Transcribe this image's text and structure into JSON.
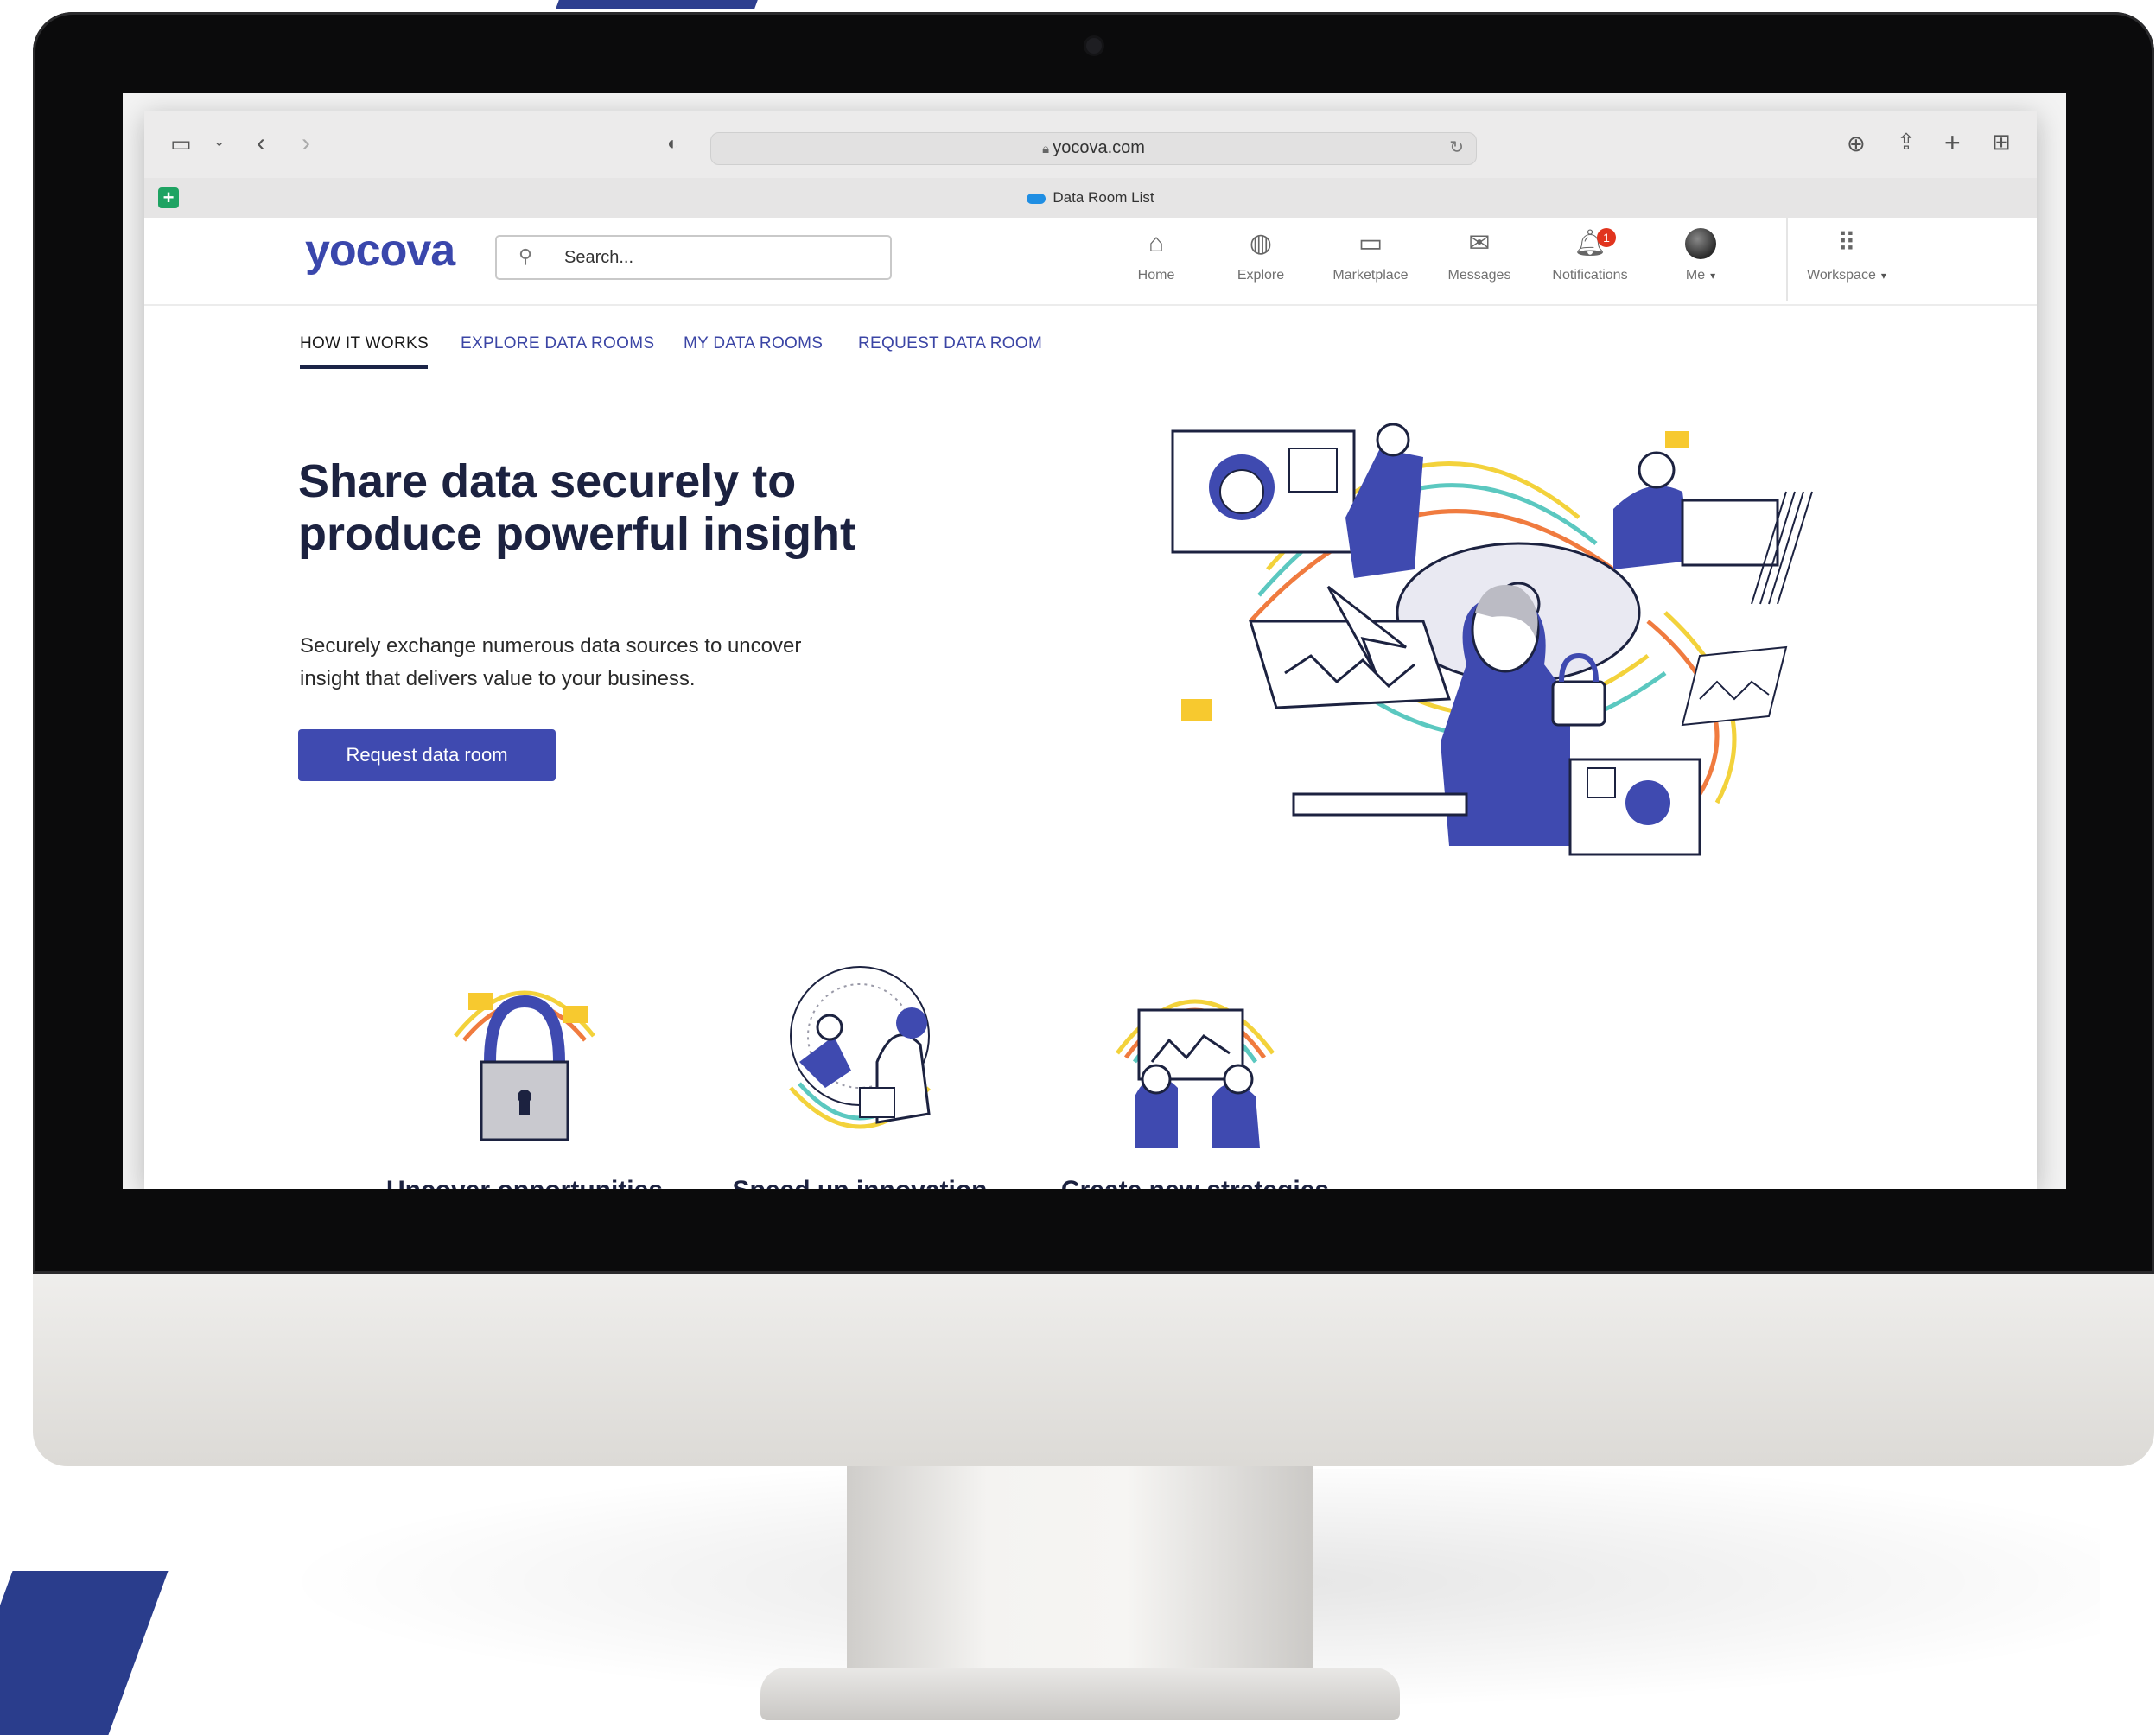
{
  "browser": {
    "url": "yocova.com",
    "tab_title": "Data Room List"
  },
  "app": {
    "logo": "yocova",
    "search_placeholder": "Search...",
    "nav": [
      {
        "label": "Home",
        "icon": "home-icon"
      },
      {
        "label": "Explore",
        "icon": "globe-icon"
      },
      {
        "label": "Marketplace",
        "icon": "monitor-icon"
      },
      {
        "label": "Messages",
        "icon": "envelope-icon"
      },
      {
        "label": "Notifications",
        "icon": "bell-icon",
        "badge": "1"
      },
      {
        "label": "Me",
        "icon": "avatar"
      },
      {
        "label": "Workspace",
        "icon": "grid-icon"
      }
    ]
  },
  "subnav": {
    "tabs": [
      "HOW IT WORKS",
      "EXPLORE DATA ROOMS",
      "MY DATA ROOMS",
      "REQUEST DATA ROOM"
    ],
    "active": "HOW IT WORKS"
  },
  "hero": {
    "title_line1": "Share data securely to",
    "title_line2": "produce powerful insight",
    "description_line1": "Securely exchange numerous data sources to uncover",
    "description_line2": "insight that delivers value to your business.",
    "cta": "Request data room"
  },
  "features": [
    {
      "title": "Uncover opportunities"
    },
    {
      "title": "Speed up innovation"
    },
    {
      "title": "Create new strategies"
    }
  ],
  "colors": {
    "brand": "#3a47ac",
    "cta": "#3f4ab0",
    "heading": "#1c2240",
    "badge": "#e1341e"
  }
}
